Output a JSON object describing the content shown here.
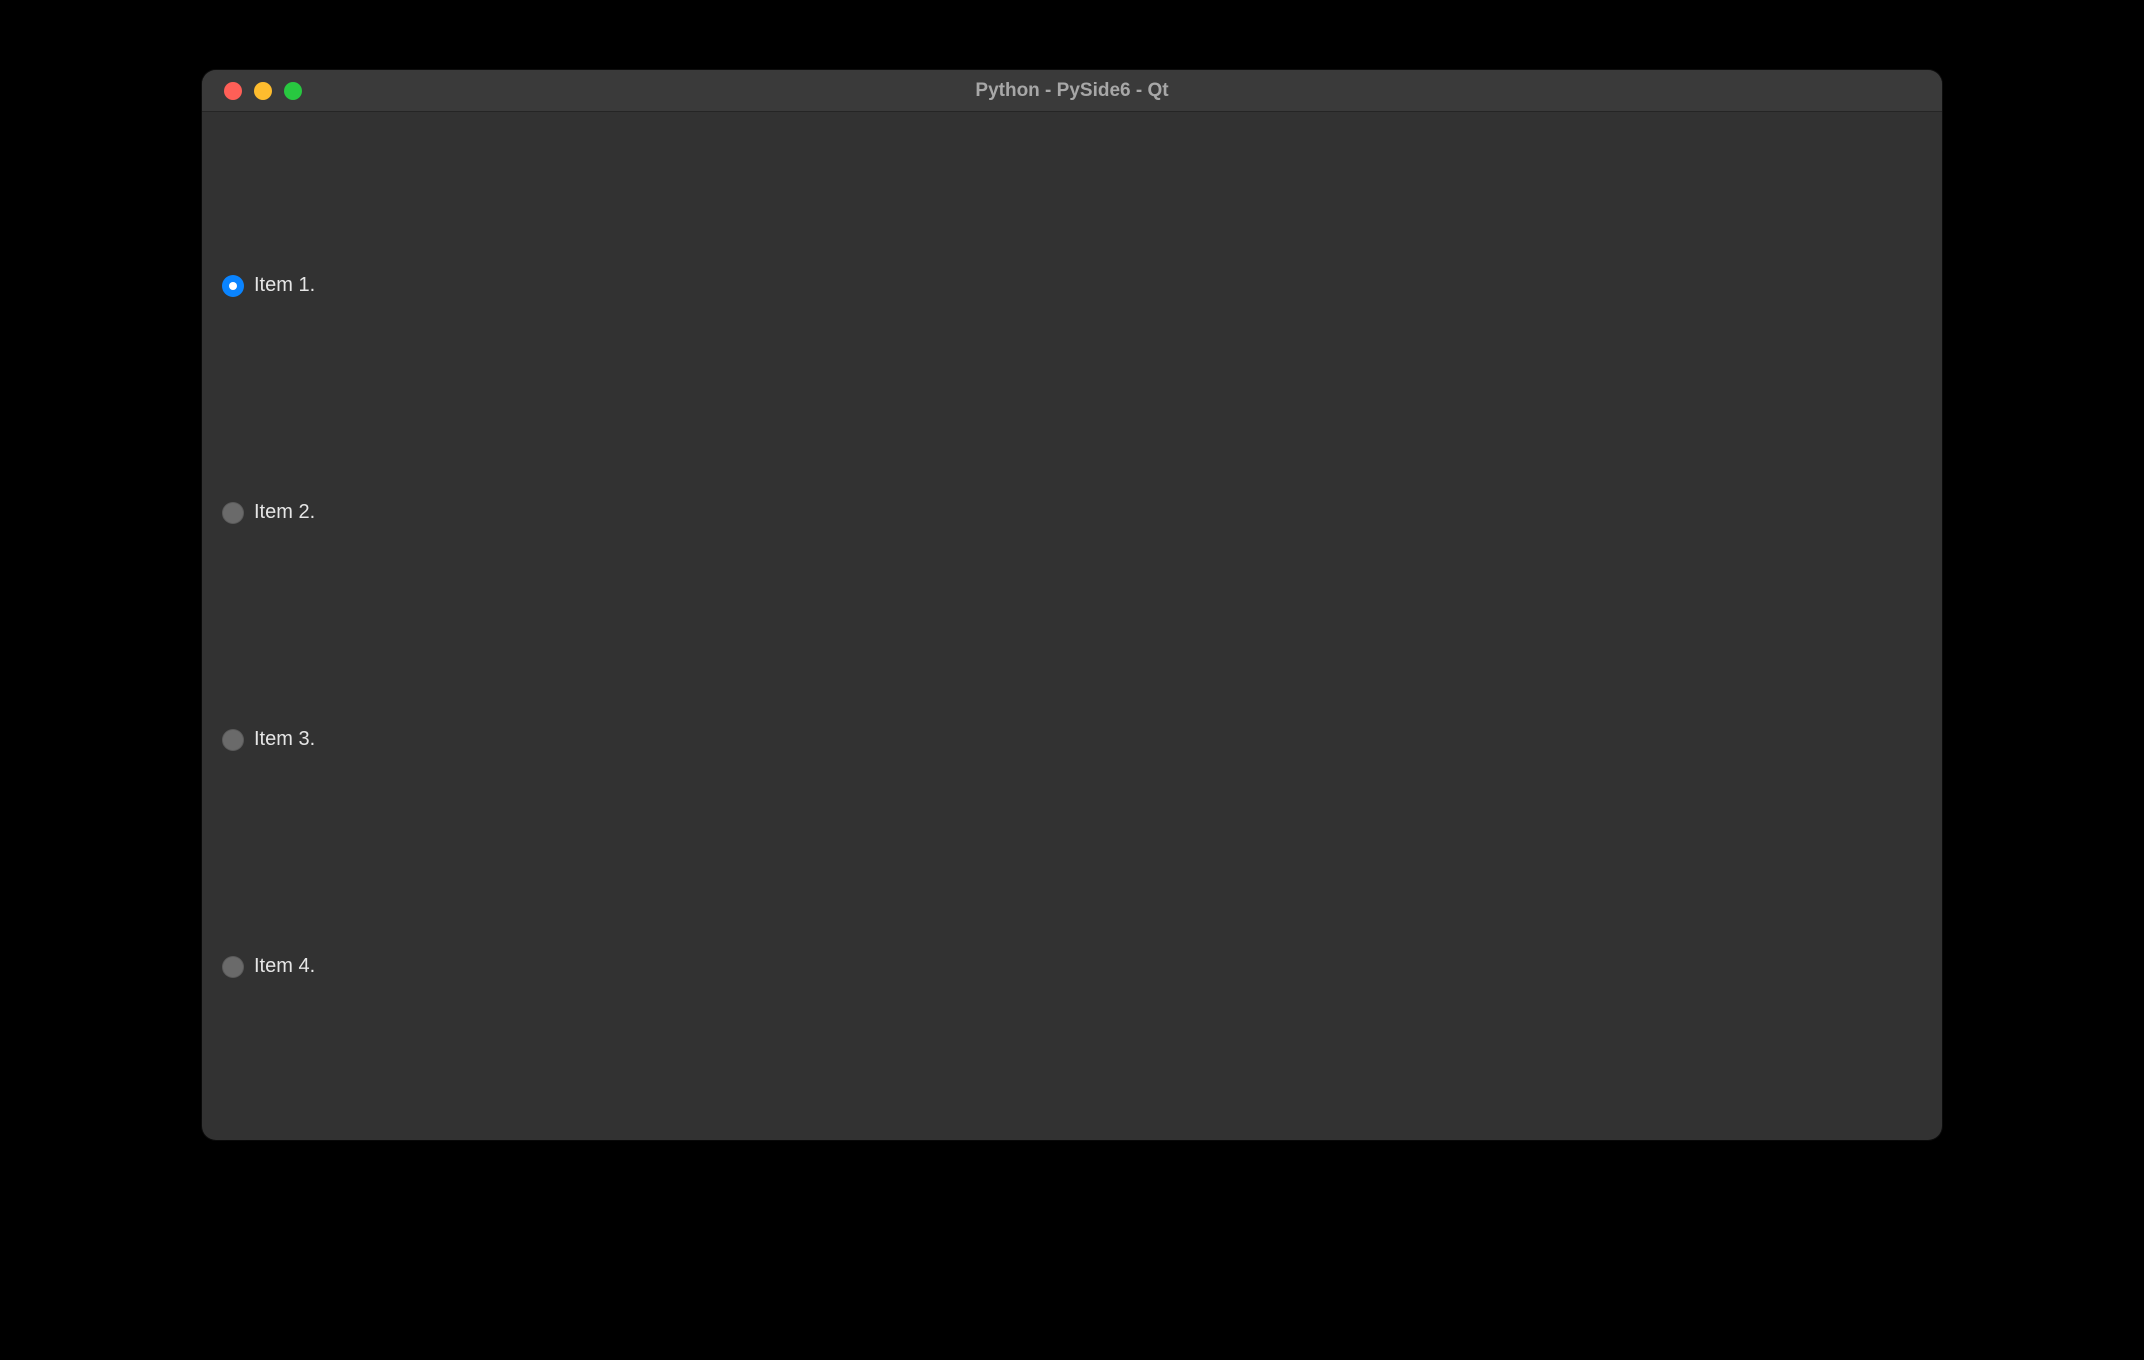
{
  "window": {
    "title": "Python - PySide6 - Qt"
  },
  "radio_group": {
    "selected_index": 0,
    "items": [
      {
        "label": "Item 1."
      },
      {
        "label": "Item 2."
      },
      {
        "label": "Item 3."
      },
      {
        "label": "Item 4."
      }
    ]
  },
  "colors": {
    "window_bg": "#323232",
    "titlebar_bg": "#3a3a3a",
    "accent": "#0a84ff",
    "radio_unchecked": "#6a6a6a",
    "text": "#e6e6e6",
    "title_text": "#a7a7a7"
  }
}
